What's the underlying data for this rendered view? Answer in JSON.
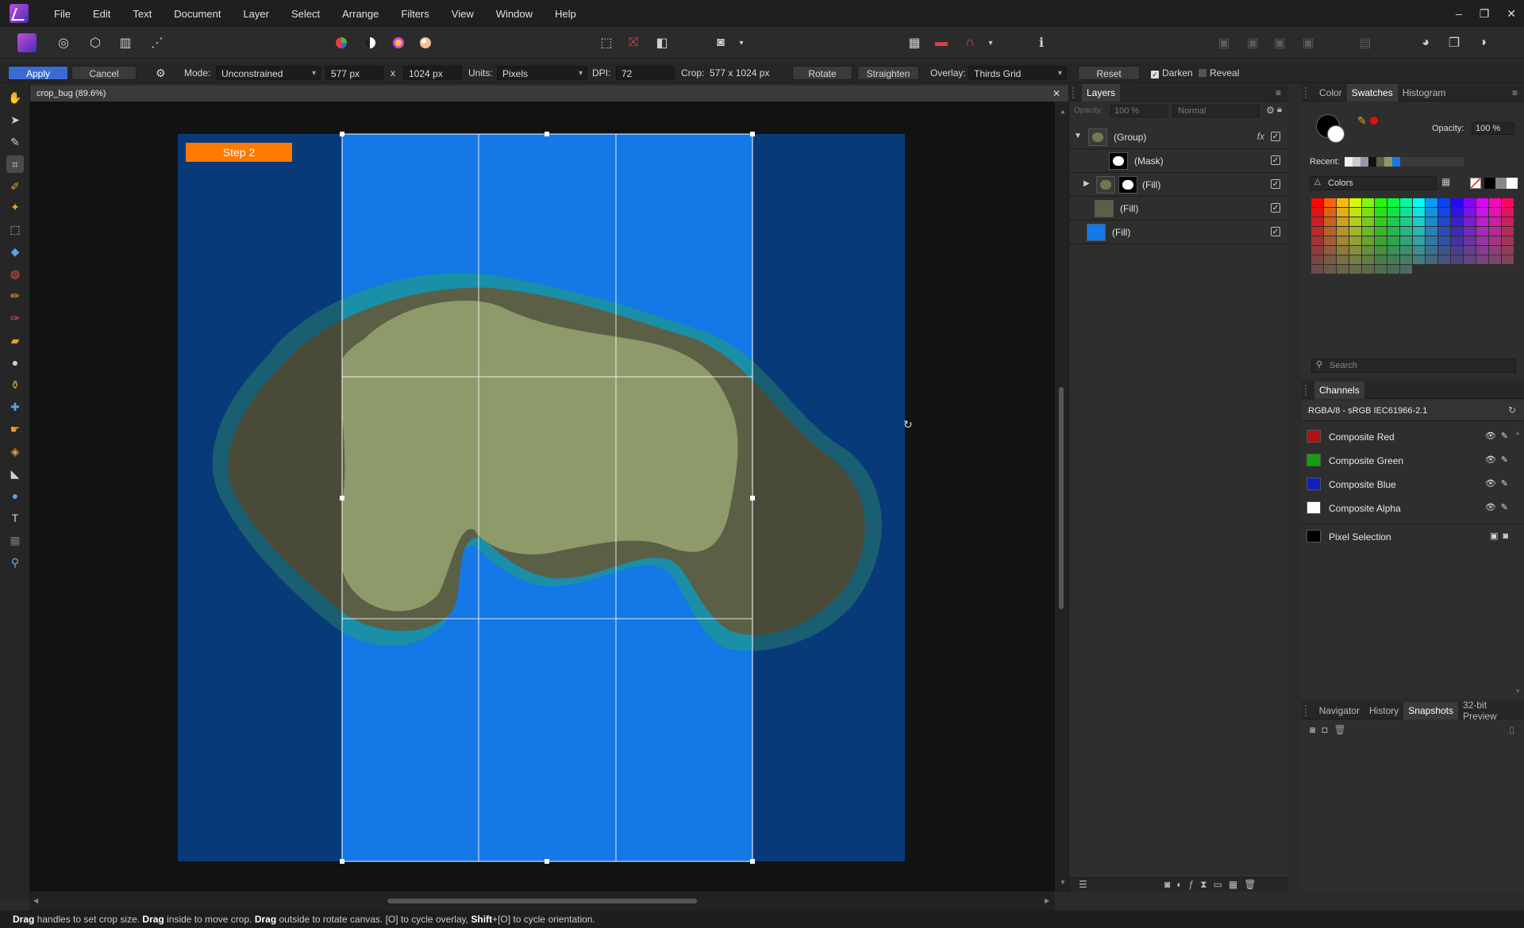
{
  "menu": [
    "File",
    "Edit",
    "Text",
    "Document",
    "Layer",
    "Select",
    "Arrange",
    "Filters",
    "View",
    "Window",
    "Help"
  ],
  "window_controls": [
    "–",
    "❐",
    "✕"
  ],
  "context_bar": {
    "apply": "Apply",
    "cancel": "Cancel",
    "mode_label": "Mode:",
    "mode_value": "Unconstrained",
    "width_value": "577 px",
    "x_label": "x",
    "height_value": "1024 px",
    "units_label": "Units:",
    "units_value": "Pixels",
    "dpi_label": "DPI:",
    "dpi_value": "72",
    "crop_label": "Crop:",
    "crop_value": "577 x 1024 px",
    "rotate": "Rotate",
    "straighten": "Straighten",
    "overlay_label": "Overlay:",
    "overlay_value": "Thirds Grid",
    "reset": "Reset",
    "darken": "Darken",
    "darken_checked": true,
    "reveal": "Reveal",
    "reveal_checked": false
  },
  "document": {
    "tab_title": "crop_bug (89.6%)",
    "close": "✕",
    "badge": "Step 2"
  },
  "layers_panel": {
    "tab": "Layers",
    "opacity_label": "Opacity:",
    "opacity_value": "100 %",
    "blend_mode": "Normal",
    "layers": [
      {
        "name": "(Group)",
        "thumb": "#6e7a52"
      },
      {
        "name": "(Mask)",
        "thumb": "#ffffff"
      },
      {
        "name": "(Fill)",
        "thumb": "#6e7a52"
      },
      {
        "name": "(Fill)",
        "thumb": "#5b5f46"
      },
      {
        "name": "(Fill)",
        "thumb": "#1478e6"
      }
    ],
    "fx_label": "fx"
  },
  "color_panel": {
    "tabs": [
      "Color",
      "Swatches",
      "Histogram"
    ],
    "active_tab": "Swatches",
    "opacity_label": "Opacity:",
    "opacity_value": "100 %",
    "recent_label": "Recent:",
    "palette_name": "Colors",
    "search_placeholder": "Search"
  },
  "channels_panel": {
    "tab": "Channels",
    "profile": "RGBA/8 - sRGB IEC61966-2.1",
    "channels": [
      {
        "name": "Composite Red",
        "swatch": "#b01010"
      },
      {
        "name": "Composite Green",
        "swatch": "#10a010"
      },
      {
        "name": "Composite Blue",
        "swatch": "#1020c0"
      },
      {
        "name": "Composite Alpha",
        "swatch": "#ffffff"
      },
      {
        "name": "Pixel Selection",
        "swatch": "#000000"
      }
    ]
  },
  "bottom_panel": {
    "tabs": [
      "Navigator",
      "History",
      "Snapshots",
      "32-bit Preview"
    ],
    "active_tab": "Snapshots"
  },
  "status": {
    "b1": "Drag",
    "t1": " handles to set crop size. ",
    "b2": "Drag",
    "t2": " inside to move crop. ",
    "b3": "Drag",
    "t3": " outside to rotate canvas. [O] to cycle overlay, ",
    "b4": "Shift",
    "t4": "+[O] to cycle orientation."
  },
  "colors": {
    "accent": "#3a6bd4",
    "badge": "#ff7a00",
    "water_deep": "#083a7a",
    "water": "#1478e6",
    "shallow": "#1a8fa8",
    "land_dark": "#4a4a38",
    "land": "#8e9a6a"
  }
}
